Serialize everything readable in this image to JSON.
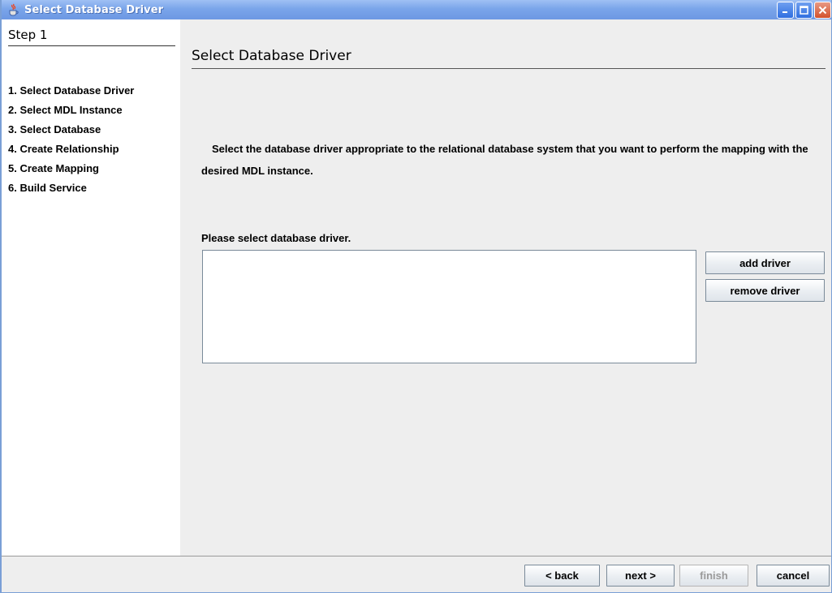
{
  "window": {
    "title": "Select Database Driver",
    "title_icon": "java-cup-icon"
  },
  "sidebar": {
    "header": "Step 1",
    "steps": [
      "1. Select Database Driver",
      "2. Select MDL Instance",
      "3. Select Database",
      "4. Create Relationship",
      "5. Create Mapping",
      "6. Build Service"
    ]
  },
  "main": {
    "title": "Select Database Driver",
    "description": "Select the database driver appropriate to the relational database system that you want to perform the mapping with the desired MDL instance.",
    "select_label": "Please select database driver.",
    "add_driver_label": "add driver",
    "remove_driver_label": "remove driver"
  },
  "footer": {
    "back_label": "< back",
    "next_label": "next >",
    "finish_label": "finish",
    "cancel_label": "cancel"
  },
  "colors": {
    "titlebar": "#7aa5ea",
    "panel_bg": "#eeeeee",
    "sidebar_bg": "#ffffff",
    "close_button": "#d3502c"
  }
}
